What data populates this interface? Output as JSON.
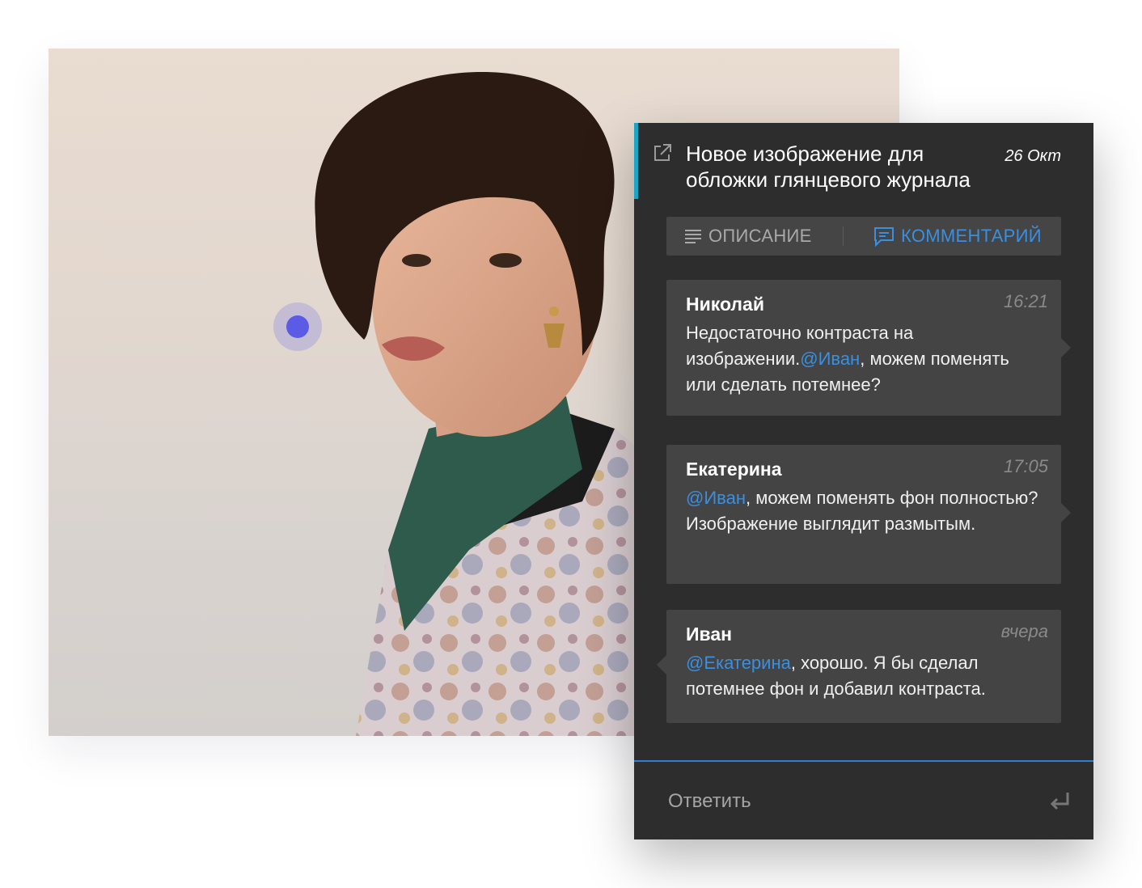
{
  "photo": {
    "alt": "",
    "pin_color": "#5b5be6"
  },
  "header": {
    "title": "Новое изображение для обложки глянцевого журнала",
    "date": "26 Окт",
    "accent_color": "#1aa6c6"
  },
  "tabs": [
    {
      "label": "ОПИСАНИЕ",
      "icon": "lines-icon",
      "active": false
    },
    {
      "label": "КОММЕНТАРИЙ",
      "icon": "comment-icon",
      "active": true
    }
  ],
  "comments": [
    {
      "author": "Николай",
      "time": "16:21",
      "text_before": "Недостаточно контраста на изображении.",
      "mention": "@Иван",
      "text_after": ", можем поменять или сделать потемнее?"
    },
    {
      "author": "Екатерина",
      "time": "17:05",
      "text_before": "",
      "mention": "@Иван",
      "text_after": ", можем поменять фон полностью? Изображение выглядит размытым."
    },
    {
      "author": "Иван",
      "time": "вчера",
      "text_before": "",
      "mention": "@Екатерина",
      "text_after": ", хорошо. Я бы сделал потемнее фон и добавил контраста."
    }
  ],
  "reply": {
    "placeholder": "Ответить",
    "value": "",
    "submit_icon": "enter-icon"
  },
  "colors": {
    "panel_bg": "#2d2d2d",
    "card_bg": "#444444",
    "mention": "#3a8fe0",
    "reply_line": "#2f7fd0"
  }
}
